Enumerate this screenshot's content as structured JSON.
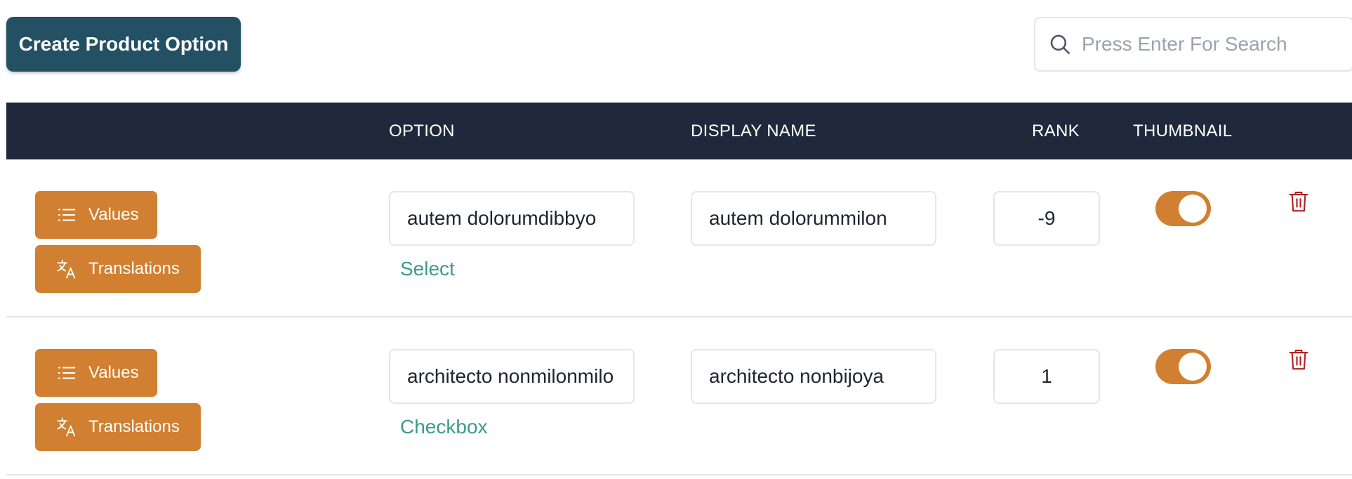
{
  "toolbar": {
    "create_label": "Create Product Option",
    "search_placeholder": "Press Enter For Search"
  },
  "table": {
    "columns": {
      "option": "OPTION",
      "display_name": "DISPLAY NAME",
      "rank": "RANK",
      "thumbnail": "THUMBNAIL"
    },
    "rows": [
      {
        "values_label": "Values",
        "translations_label": "Translations",
        "option": "autem dolorumdibbyo",
        "option_type": "Select",
        "display_name": "autem dolorummilon",
        "rank": "-9",
        "thumbnail": true
      },
      {
        "values_label": "Values",
        "translations_label": "Translations",
        "option": "architecto nonmilonmilo",
        "option_type": "Checkbox",
        "display_name": "architecto nonbijoya",
        "rank": "1",
        "thumbnail": true
      }
    ]
  },
  "icons": {
    "search": "search-icon",
    "values": "list-icon",
    "translations": "translate-icon",
    "delete": "trash-icon"
  },
  "colors": {
    "primary": "#245063",
    "header": "#1f293b",
    "accent": "#d17f30",
    "option_type": "#3c9a8a",
    "delete": "#b22222"
  }
}
